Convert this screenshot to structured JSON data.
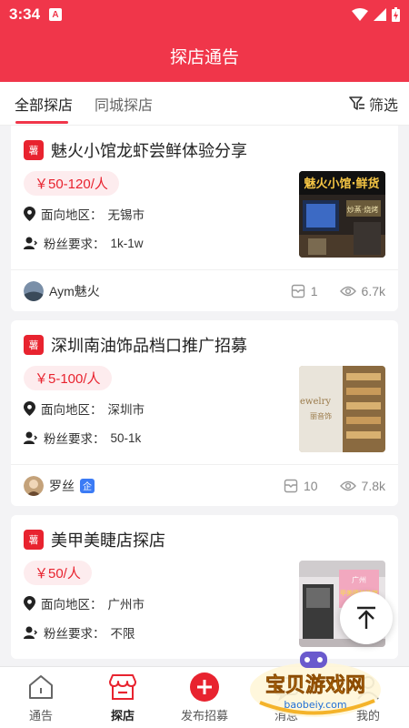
{
  "status": {
    "time": "3:34",
    "notif_icon": "A"
  },
  "header": {
    "title": "探店通告"
  },
  "tabs": [
    {
      "label": "全部探店",
      "active": true
    },
    {
      "label": "同城探店",
      "active": false
    }
  ],
  "filter": {
    "label": "筛选"
  },
  "cards": [
    {
      "tag": "薯",
      "title": "魅火小馆龙虾尝鲜体验分享",
      "price": "￥50-120/人",
      "region_label": "面向地区：",
      "region": "无锡市",
      "fans_label": "粉丝要求：",
      "fans": "1k-1w",
      "user": "Aym魅火",
      "verified": false,
      "applies": "1",
      "views": "6.7k"
    },
    {
      "tag": "薯",
      "title": "深圳南油饰品档口推广招募",
      "price": "￥5-100/人",
      "region_label": "面向地区：",
      "region": "深圳市",
      "fans_label": "粉丝要求：",
      "fans": "50-1k",
      "user": "罗丝",
      "verified": true,
      "verified_label": "企",
      "applies": "10",
      "views": "7.8k"
    },
    {
      "tag": "薯",
      "title": "美甲美睫店探店",
      "price": "￥50/人",
      "region_label": "面向地区：",
      "region": "广州市",
      "fans_label": "粉丝要求：",
      "fans": "不限"
    }
  ],
  "thumb_text": {
    "t1_sign": "魅火小馆·鲜货",
    "t1_sub": "炒蒸·烧烤",
    "t2_sign": "ewelry",
    "t2_sub": "丽音饰",
    "t3_sign": "广州",
    "t3_sub": "甲美睫护肤馆"
  },
  "nav": [
    {
      "label": "通告",
      "icon": "home-icon",
      "active": false
    },
    {
      "label": "探店",
      "icon": "store-icon",
      "active": true
    },
    {
      "label": "发布招募",
      "icon": "plus-icon",
      "active": false
    },
    {
      "label": "消息",
      "icon": "message-icon",
      "active": false
    },
    {
      "label": "我的",
      "icon": "profile-icon",
      "active": false
    }
  ],
  "watermark": {
    "title": "宝贝游戏网",
    "url": "baobeiy.com"
  },
  "colors": {
    "brand": "#f0364a",
    "accent": "#e8232f",
    "price_bg": "#fdecee"
  }
}
